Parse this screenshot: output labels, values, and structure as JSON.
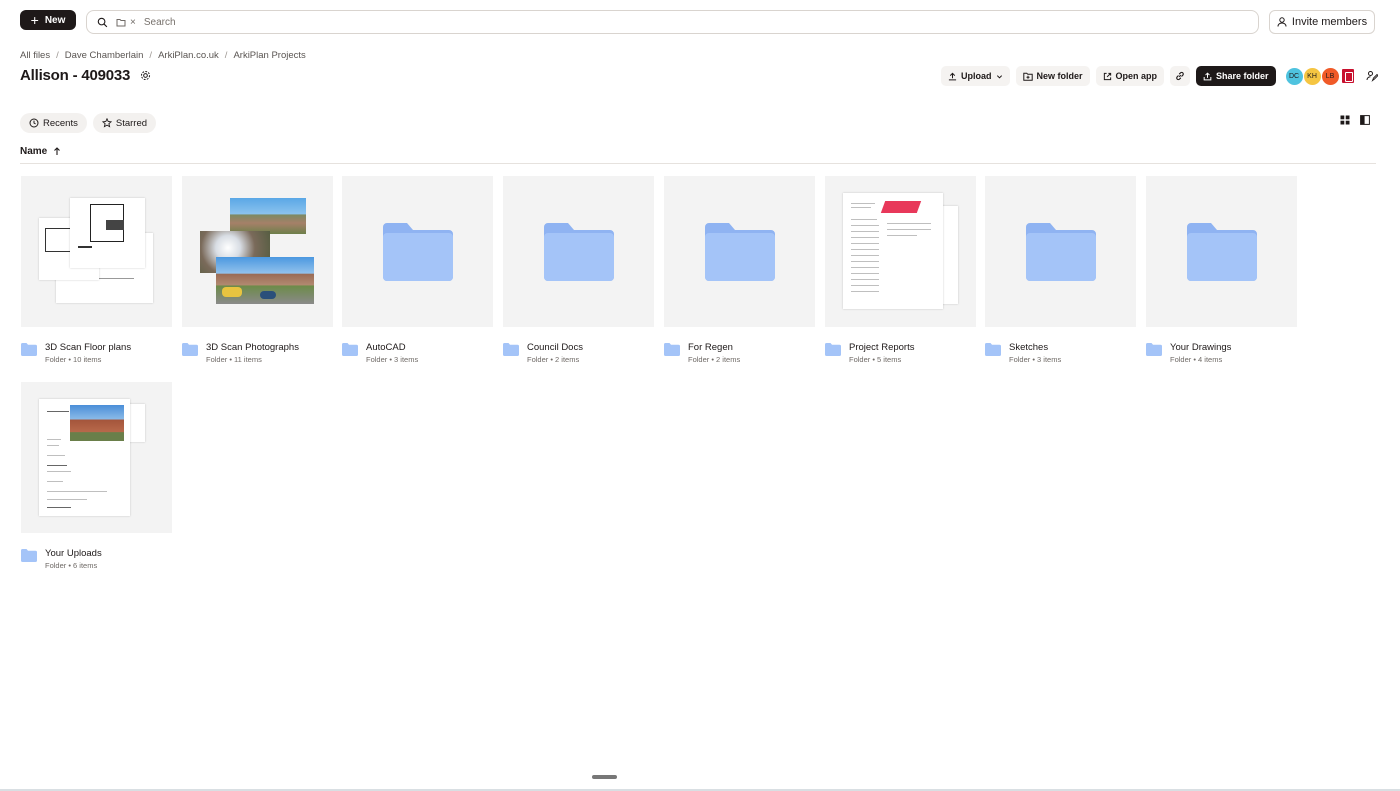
{
  "topbar": {
    "new_label": "New",
    "search_placeholder": "Search",
    "chip_close": "×",
    "invite_label": "Invite members"
  },
  "breadcrumb": [
    "All files",
    "Dave Chamberlain",
    "ArkiPlan.co.uk",
    "ArkiPlan Projects"
  ],
  "breadcrumb_sep": "/",
  "page_title": "Allison - 409033",
  "actions": {
    "upload": "Upload",
    "new_folder": "New folder",
    "open_app": "Open app",
    "share_folder": "Share folder"
  },
  "avatars": [
    {
      "initials": "DC",
      "color": "#4fc3df"
    },
    {
      "initials": "KH",
      "color": "#f5c542"
    },
    {
      "initials": "LB",
      "color": "#f05a28"
    }
  ],
  "filters": {
    "recents": "Recents",
    "starred": "Starred"
  },
  "column_header": "Name",
  "folders": [
    {
      "name": "3D Scan Floor plans",
      "sub": "Folder • 10 items",
      "thumb": "floorplan"
    },
    {
      "name": "3D Scan Photographs",
      "sub": "Folder • 11 items",
      "thumb": "photos"
    },
    {
      "name": "AutoCAD",
      "sub": "Folder • 3 items",
      "thumb": "folder"
    },
    {
      "name": "Council Docs",
      "sub": "Folder • 2 items",
      "thumb": "folder"
    },
    {
      "name": "For Regen",
      "sub": "Folder • 2 items",
      "thumb": "folder"
    },
    {
      "name": "Project Reports",
      "sub": "Folder • 5 items",
      "thumb": "report"
    },
    {
      "name": "Sketches",
      "sub": "Folder • 3 items",
      "thumb": "folder"
    },
    {
      "name": "Your Drawings",
      "sub": "Folder • 4 items",
      "thumb": "folder"
    },
    {
      "name": "Your Uploads",
      "sub": "Folder • 6 items",
      "thumb": "uploads"
    }
  ],
  "colors": {
    "folder_blue": "#a4c4f8",
    "folder_blue_dark": "#8fb3f2",
    "primary_dark": "#1e1919"
  }
}
